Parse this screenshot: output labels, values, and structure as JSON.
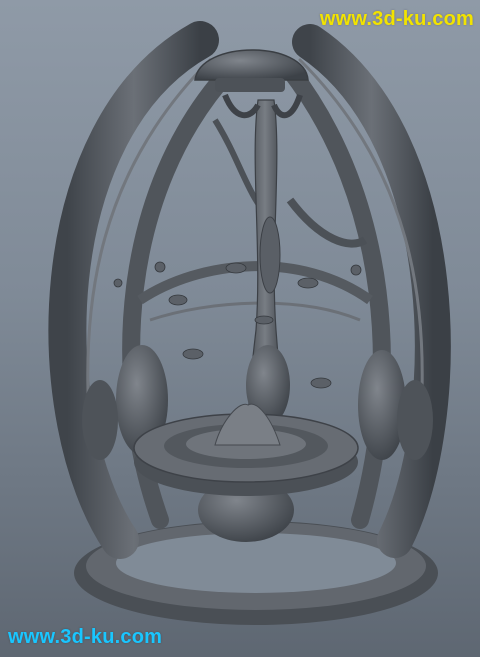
{
  "watermark": {
    "top_text": "www.3d-ku.com",
    "bottom_text": "www.3d-ku.com",
    "color": "#f2e300",
    "bottom_color": "#19c6ff"
  },
  "scene": {
    "subject": "grey-shaded-3d-model-egg-shaped-cage-with-central-pillar",
    "background_top": "#8f9aa7",
    "background_bottom": "#5e6772",
    "model_color": "#5a5f66"
  }
}
